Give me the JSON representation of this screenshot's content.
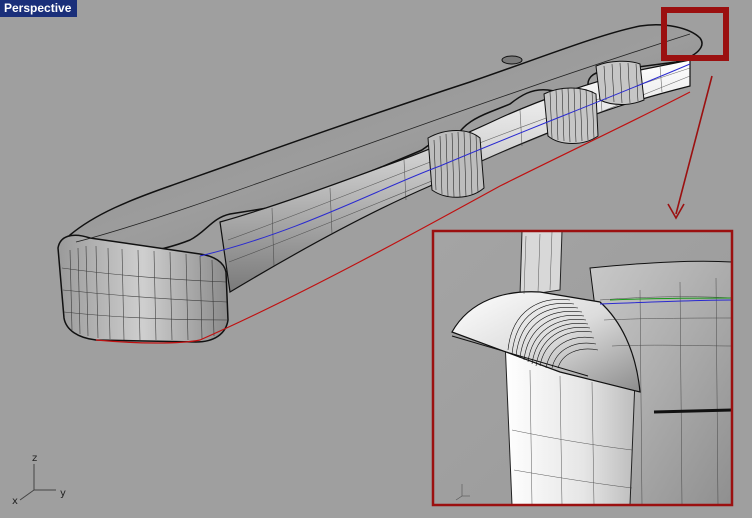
{
  "viewport": {
    "title": "Perspective"
  },
  "axes": {
    "z": "z",
    "y": "y",
    "x": "x"
  },
  "colors": {
    "title_bg": "#1a2f7a",
    "background": "#9f9f9f",
    "highlight": "#9b1010",
    "edge_blue": "#2a2ad0",
    "edge_red": "#c01010"
  },
  "icons": {
    "arrow": "callout-arrow-icon"
  }
}
